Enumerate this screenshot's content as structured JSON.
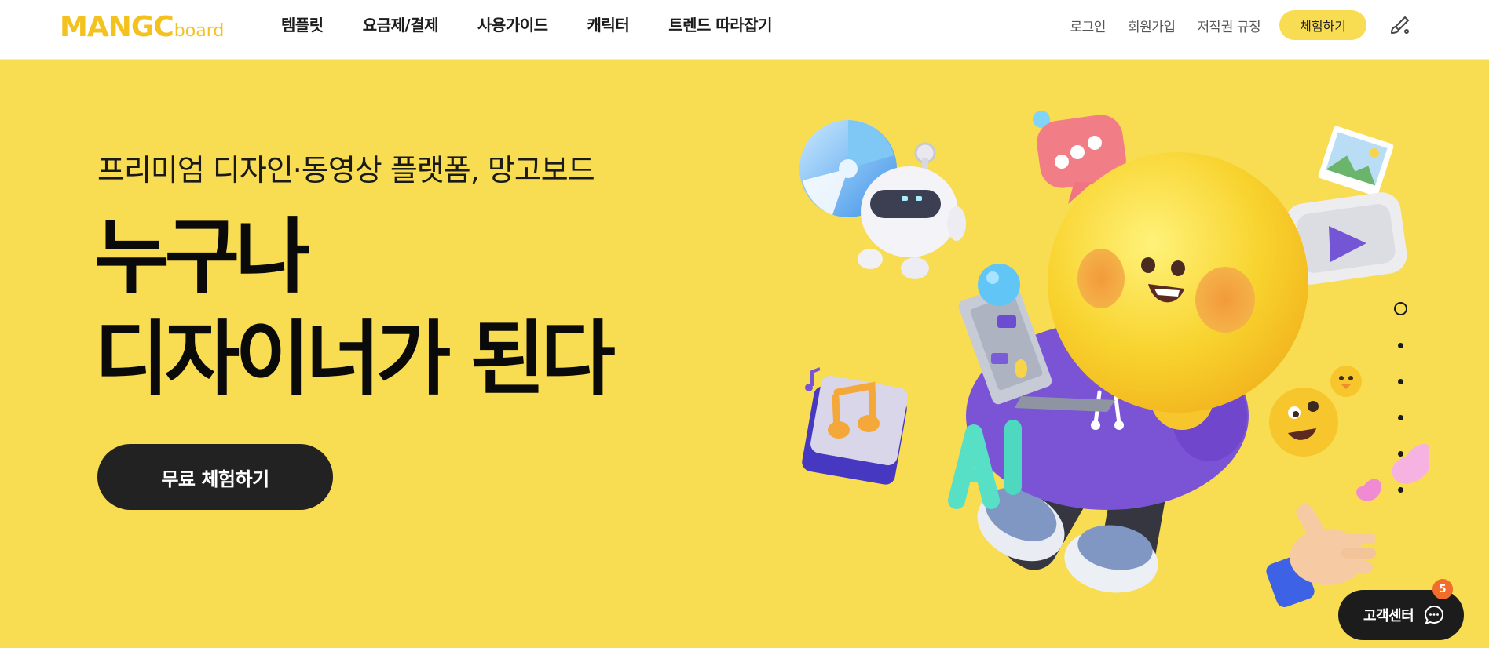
{
  "header": {
    "logo": {
      "main": "MANGC",
      "sub": "board"
    },
    "nav": [
      "템플릿",
      "요금제/결제",
      "사용가이드",
      "캐릭터",
      "트렌드 따라잡기"
    ],
    "util": {
      "login": "로그인",
      "signup": "회원가입",
      "copyright": "저작권 규정",
      "trial": "체험하기"
    },
    "brush_icon": "paintbrush-icon"
  },
  "hero": {
    "subtitle": "프리미엄 디자인·동영상 플랫폼, 망고보드",
    "headline_line1": "누구나",
    "headline_line2": "디자이너가 된다",
    "cta": "무료 체험하기",
    "illustration_icons": [
      "cd-icon",
      "robot-icon",
      "chat-bubble-icon",
      "photo-icon",
      "play-icon",
      "mango-character",
      "laptop-icon",
      "music-note-icon",
      "ai-letters",
      "emoji-icon",
      "heart-icon",
      "thumbs-up-hand"
    ]
  },
  "pager": {
    "count": 6,
    "active": 0
  },
  "customer_center": {
    "label": "고객센터",
    "badge": "5",
    "icon": "chat-icon"
  },
  "colors": {
    "brand_yellow": "#f8dc52",
    "logo_yellow": "#f4c21f",
    "dark": "#222222",
    "badge": "#f06d2c",
    "purple": "#7b54d6"
  }
}
